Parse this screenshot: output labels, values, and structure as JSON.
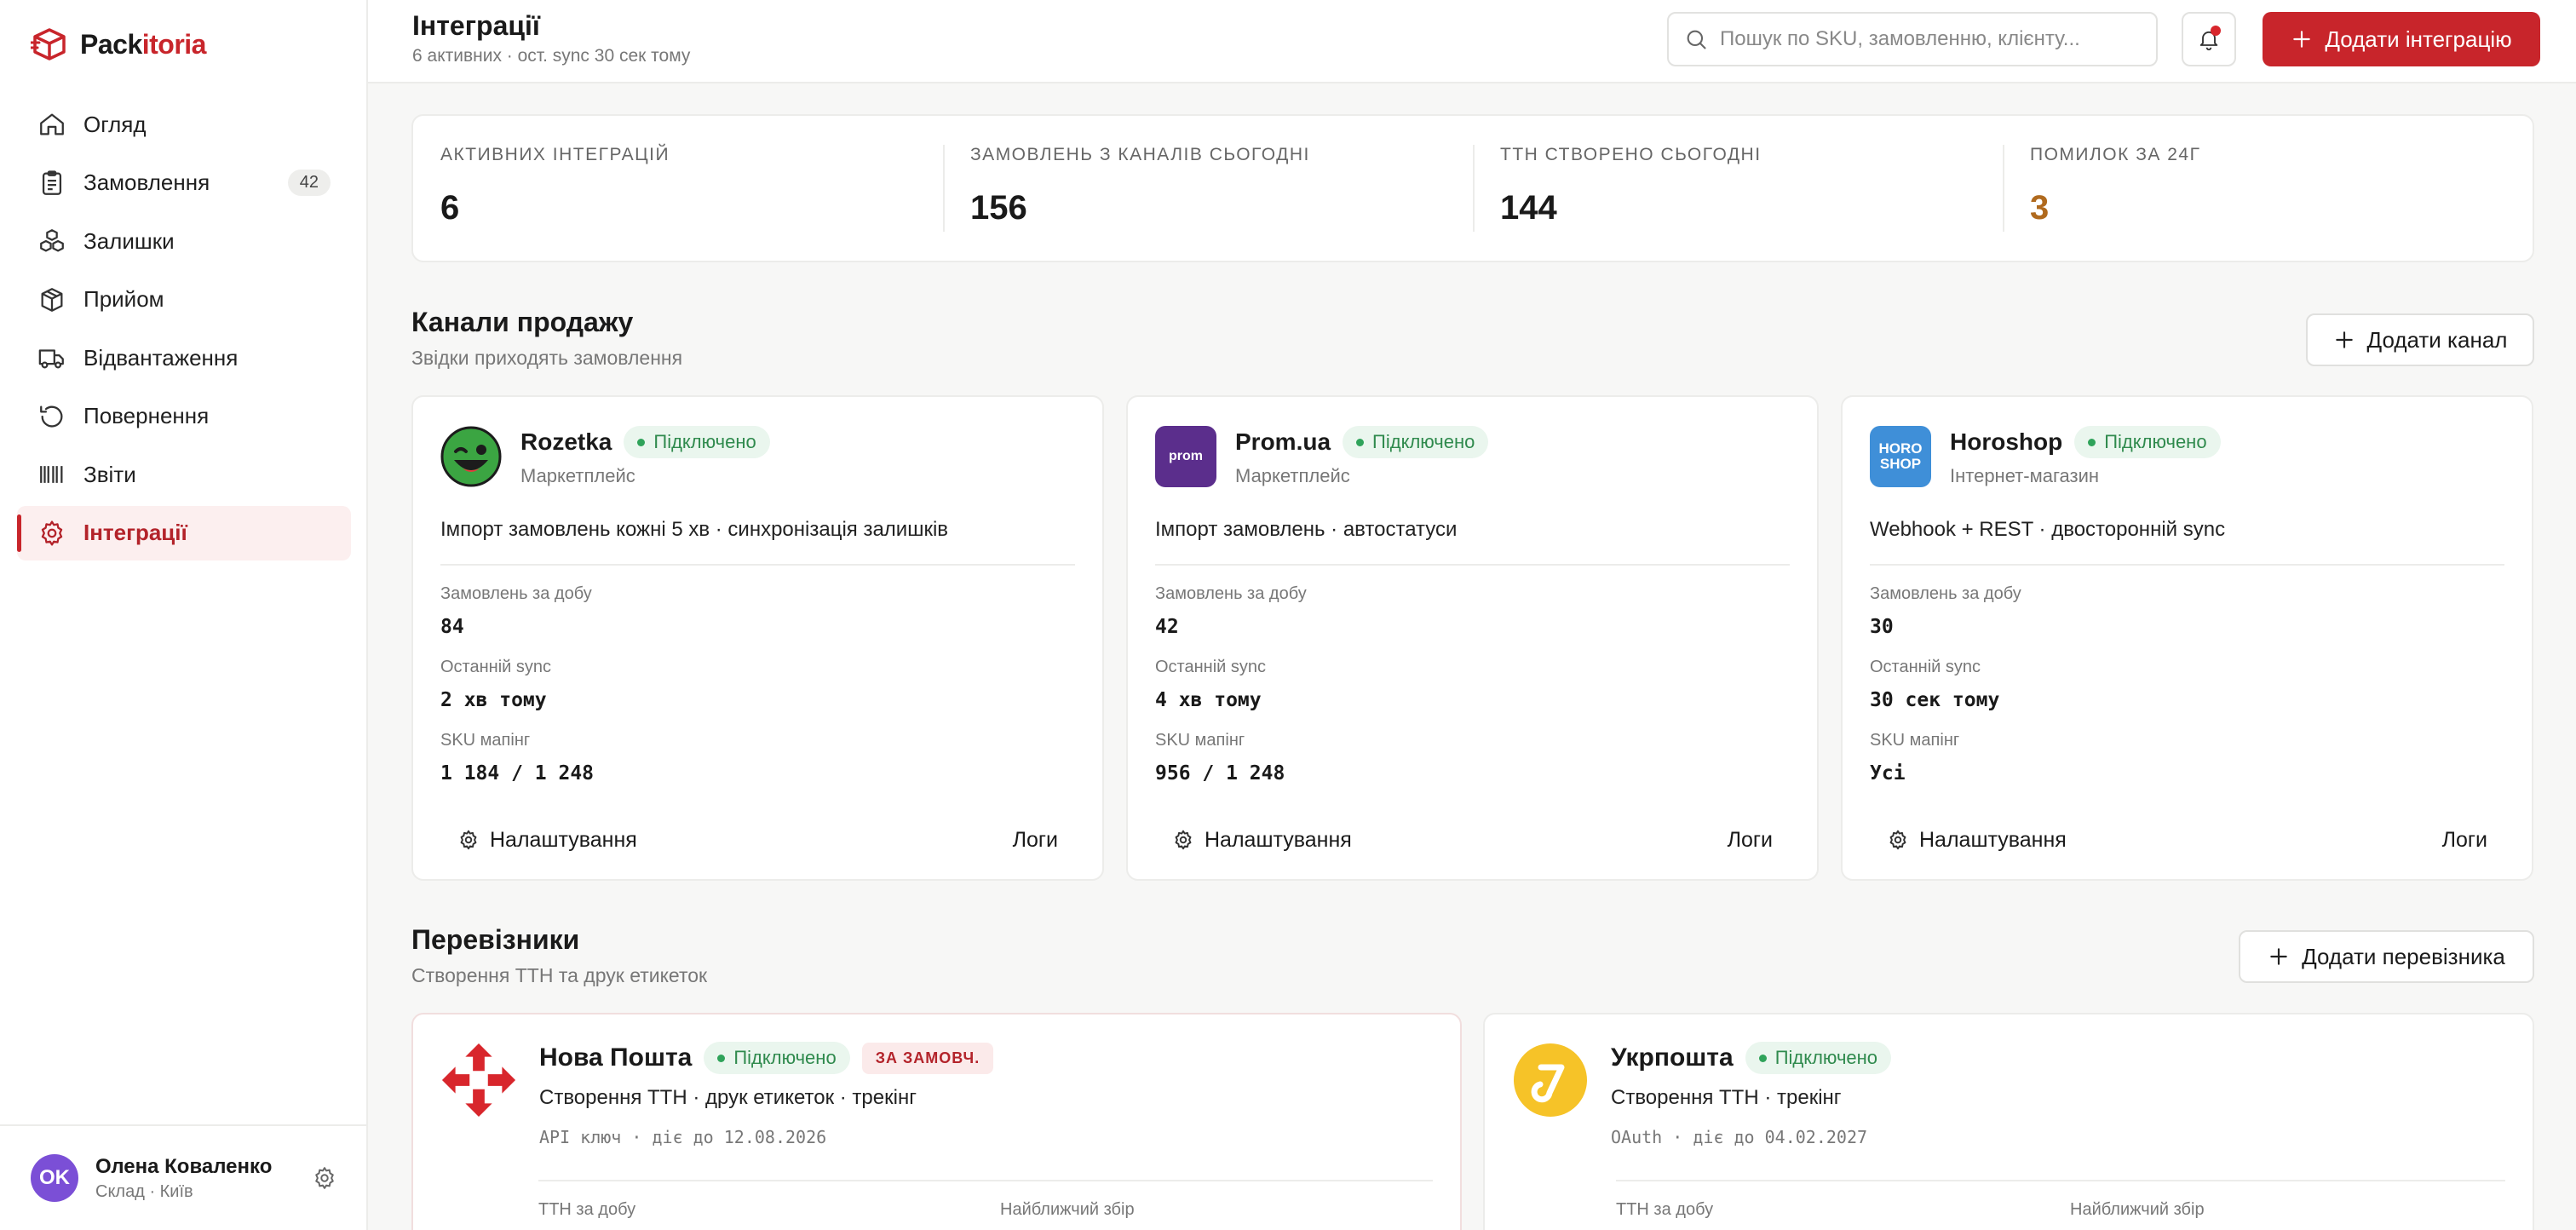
{
  "brand": {
    "name_part1": "Pack",
    "name_part2": "itoria",
    "accent": "#c8252b"
  },
  "sidebar": {
    "items": [
      {
        "label": "Огляд",
        "icon": "home-icon"
      },
      {
        "label": "Замовлення",
        "icon": "clipboard-icon",
        "badge": "42"
      },
      {
        "label": "Залишки",
        "icon": "boxes-icon"
      },
      {
        "label": "Прийом",
        "icon": "package-icon"
      },
      {
        "label": "Відвантаження",
        "icon": "truck-icon"
      },
      {
        "label": "Повернення",
        "icon": "return-icon"
      },
      {
        "label": "Звіти",
        "icon": "barcode-icon"
      },
      {
        "label": "Інтеграції",
        "icon": "gear-icon",
        "active": true
      }
    ],
    "user": {
      "initials": "OK",
      "name": "Олена Коваленко",
      "role": "Склад · Київ"
    }
  },
  "header": {
    "title": "Інтеграції",
    "subtitle": "6 активних · ост. sync 30 сек тому",
    "search_placeholder": "Пошук по SKU, замовленню, клієнту...",
    "add_button": "Додати інтеграцію"
  },
  "stats": [
    {
      "label": "АКТИВНИХ ІНТЕГРАЦІЙ",
      "value": "6"
    },
    {
      "label": "ЗАМОВЛЕНЬ З КАНАЛІВ СЬОГОДНІ",
      "value": "156"
    },
    {
      "label": "ТТН СТВОРЕНО СЬОГОДНІ",
      "value": "144"
    },
    {
      "label": "ПОМИЛОК ЗА 24Г",
      "value": "3",
      "color": "#b06a1e"
    }
  ],
  "channels_section": {
    "title": "Канали продажу",
    "subtitle": "Звідки приходять замовлення",
    "add_button": "Додати канал",
    "labels": {
      "orders": "Замовлень за добу",
      "last_sync": "Останній sync",
      "sku": "SKU мапінг"
    },
    "settings_label": "Налаштування",
    "logs_label": "Логи",
    "cards": [
      {
        "name": "Rozetka",
        "status": "Підключено",
        "type": "Маркетплейс",
        "desc": "Імпорт замовлень кожні 5 хв · синхронізація залишків",
        "orders": "84",
        "last_sync": "2 хв тому",
        "sku": "1 184 / 1 248"
      },
      {
        "name": "Prom.ua",
        "status": "Підключено",
        "type": "Маркетплейс",
        "desc": "Імпорт замовлень · автостатуси",
        "orders": "42",
        "last_sync": "4 хв тому",
        "sku": "956 / 1 248",
        "logo_text": "prom"
      },
      {
        "name": "Horoshop",
        "status": "Підключено",
        "type": "Інтернет-магазин",
        "desc": "Webhook + REST · двосторонній sync",
        "orders": "30",
        "last_sync": "30 сек тому",
        "sku": "Усі",
        "logo_text_1": "HORO",
        "logo_text_2": "SHOP"
      }
    ]
  },
  "carriers_section": {
    "title": "Перевізники",
    "subtitle": "Створення ТТН та друк етикеток",
    "add_button": "Додати перевізника",
    "labels": {
      "ttn": "ТТН за добу",
      "pickup": "Найближчий збір"
    },
    "cards": [
      {
        "name": "Нова Пошта",
        "status": "Підключено",
        "tag": "ЗА ЗАМОВЧ.",
        "desc": "Створення ТТН · друк етикеток · трекінг",
        "key": "API ключ · діє до 12.08.2026"
      },
      {
        "name": "Укрпошта",
        "status": "Підключено",
        "desc": "Створення ТТН · трекінг",
        "key": "OAuth · діє до 04.02.2027"
      }
    ]
  }
}
